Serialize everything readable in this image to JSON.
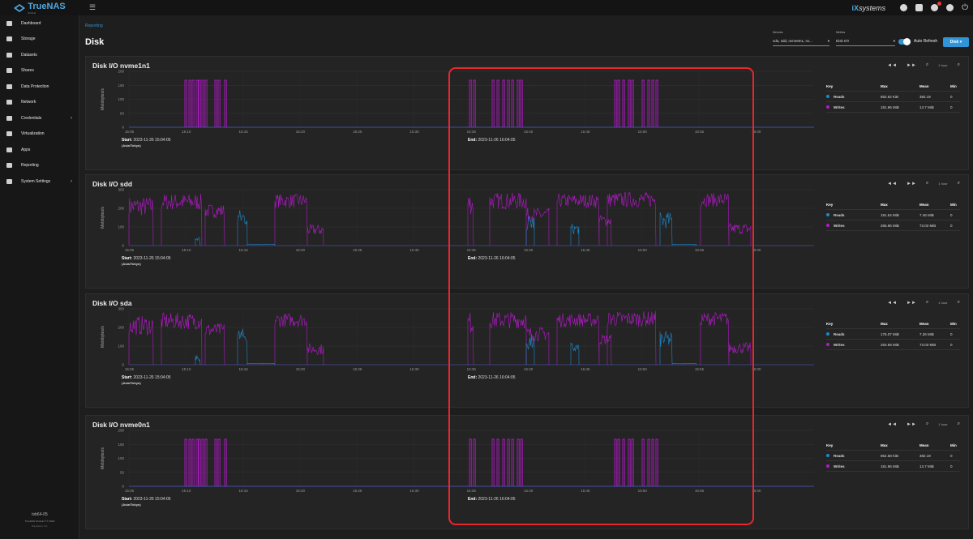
{
  "topbar": {
    "brand": "TrueNAS",
    "edition": "SCALE",
    "vendor": "systems",
    "notification_count": "1"
  },
  "sidebar": {
    "items": [
      {
        "label": "Dashboard",
        "icon": "dashboard-icon",
        "chevron": false
      },
      {
        "label": "Storage",
        "icon": "storage-icon",
        "chevron": false
      },
      {
        "label": "Datasets",
        "icon": "datasets-icon",
        "chevron": false
      },
      {
        "label": "Shares",
        "icon": "folder-icon",
        "chevron": false
      },
      {
        "label": "Data Protection",
        "icon": "shield-icon",
        "chevron": false
      },
      {
        "label": "Network",
        "icon": "network-icon",
        "chevron": false
      },
      {
        "label": "Credentials",
        "icon": "key-icon",
        "chevron": true
      },
      {
        "label": "Virtualization",
        "icon": "monitor-icon",
        "chevron": false
      },
      {
        "label": "Apps",
        "icon": "apps-grid-icon",
        "chevron": false
      },
      {
        "label": "Reporting",
        "icon": "reporting-icon",
        "chevron": false
      },
      {
        "label": "System Settings",
        "icon": "gear-icon",
        "chevron": true
      }
    ],
    "hostname": "tvb64-05",
    "version": "TrueNAS SCALE ® © 2023",
    "copyright": "iXsystems, Inc."
  },
  "page": {
    "breadcrumb": "Reporting",
    "title": "Disk"
  },
  "controls": {
    "devices_label": "Devices",
    "devices_value": "sda, sdd, nvme0n1, nv...",
    "metrics_label": "Metrics",
    "metrics_value": "Disk I/O",
    "auto_refresh_label": "Auto Refresh",
    "auto_refresh_on": true,
    "report_button": "Disk"
  },
  "range_label": "1 hour",
  "axis": {
    "ylabel": "Mebibytes/s",
    "xticks": [
      "15:05",
      "15:10",
      "15:15",
      "15:20",
      "15:25",
      "15:30",
      "15:35",
      "15:40",
      "15:45",
      "15:50",
      "15:55",
      "16:00"
    ]
  },
  "legend_headers": {
    "key": "Key",
    "max": "Max",
    "mean": "Mean",
    "min": "Min"
  },
  "colors": {
    "reads": "#1e88c8",
    "writes": "#b219c8",
    "accent": "#2f95d8",
    "highlight": "#e8262e"
  },
  "panels": [
    {
      "title": "Disk I/O nvme1n1",
      "start_label": "Start:",
      "start": "2023-11-26 15:04:05",
      "timezone": "(Asia/Tokyo)",
      "end_label": "End:",
      "end": "2023-11-26 16:04:05",
      "yticks": [
        "200",
        "150",
        "100",
        "50",
        "0"
      ],
      "legend": [
        {
          "name": "Reads",
          "max": "852.62 KiB",
          "mean": "382.19",
          "min": "0"
        },
        {
          "name": "Writes",
          "max": "181.96 MiB",
          "mean": "13.7 MiB",
          "min": "0"
        }
      ]
    },
    {
      "title": "Disk I/O sdd",
      "start_label": "Start:",
      "start": "2023-11-26 15:04:05",
      "timezone": "(Asia/Tokyo)",
      "end_label": "End:",
      "end": "2023-11-26 16:04:05",
      "yticks": [
        "300",
        "200",
        "100",
        "0"
      ],
      "legend": [
        {
          "name": "Reads",
          "max": "191.54 MiB",
          "mean": "7.46 MiB",
          "min": "0"
        },
        {
          "name": "Writes",
          "max": "266.96 MiB",
          "mean": "73.03 MiB",
          "min": "0"
        }
      ]
    },
    {
      "title": "Disk I/O sda",
      "start_label": "Start:",
      "start": "2023-11-26 15:04:05",
      "timezone": "(Asia/Tokyo)",
      "end_label": "End:",
      "end": "2023-11-26 16:04:05",
      "yticks": [
        "300",
        "200",
        "100",
        "0"
      ],
      "legend": [
        {
          "name": "Reads",
          "max": "176.07 MiB",
          "mean": "7.26 MiB",
          "min": "0"
        },
        {
          "name": "Writes",
          "max": "263.58 MiB",
          "mean": "73.03 MiB",
          "min": "0"
        }
      ]
    },
    {
      "title": "Disk I/O nvme0n1",
      "start_label": "Start:",
      "start": "2023-11-26 15:04:05",
      "timezone": "(Asia/Tokyo)",
      "end_label": "End:",
      "end": "2023-11-26 16:04:05",
      "yticks": [
        "200",
        "150",
        "100",
        "50",
        "0"
      ],
      "legend": [
        {
          "name": "Reads",
          "max": "852.58 KiB",
          "mean": "382.19",
          "min": "0"
        },
        {
          "name": "Writes",
          "max": "181.96 MiB",
          "mean": "13.7 MiB",
          "min": "0"
        }
      ]
    }
  ]
}
